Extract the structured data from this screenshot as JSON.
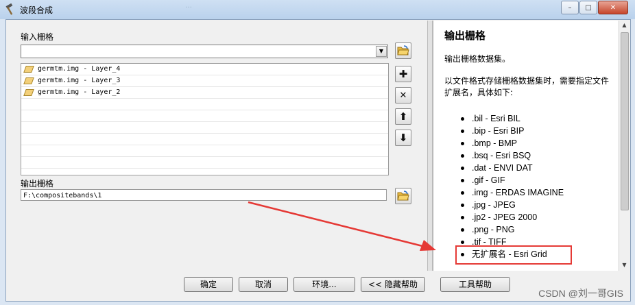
{
  "window": {
    "title": "波段合成",
    "ghost_title": "…",
    "controls": {
      "minimize": "–",
      "maximize": "□",
      "close": "✕"
    }
  },
  "input_rasters": {
    "label": "输入栅格",
    "combo_value": "",
    "items": [
      "germtm.img - Layer_4",
      "germtm.img - Layer_3",
      "germtm.img - Layer_2"
    ]
  },
  "output_raster": {
    "label": "输出栅格",
    "value": "F:\\compositebands\\1"
  },
  "side_buttons": {
    "add": "✚",
    "remove": "✕",
    "up": "⬆",
    "down": "⬇"
  },
  "help": {
    "title": "输出栅格",
    "p1": "输出栅格数据集。",
    "p2": "以文件格式存储栅格数据集时，需要指定文件扩展名，具体如下:",
    "formats": [
      ".bil - Esri BIL",
      ".bip - Esri BIP",
      ".bmp - BMP",
      ".bsq - Esri BSQ",
      ".dat - ENVI DAT",
      ".gif - GIF",
      ".img - ERDAS IMAGINE",
      ".jpg - JPEG",
      ".jp2 - JPEG 2000",
      ".png - PNG",
      ".tif - TIFF",
      "无扩展名 - Esri Grid"
    ]
  },
  "buttons": {
    "ok": "确定",
    "cancel": "取消",
    "env": "环境...",
    "hide_help": "<< 隐藏帮助",
    "tool_help": "工具帮助"
  },
  "watermark": "CSDN @刘一哥GIS",
  "colors": {
    "highlight": "#e53935",
    "arrow": "#e53935"
  }
}
